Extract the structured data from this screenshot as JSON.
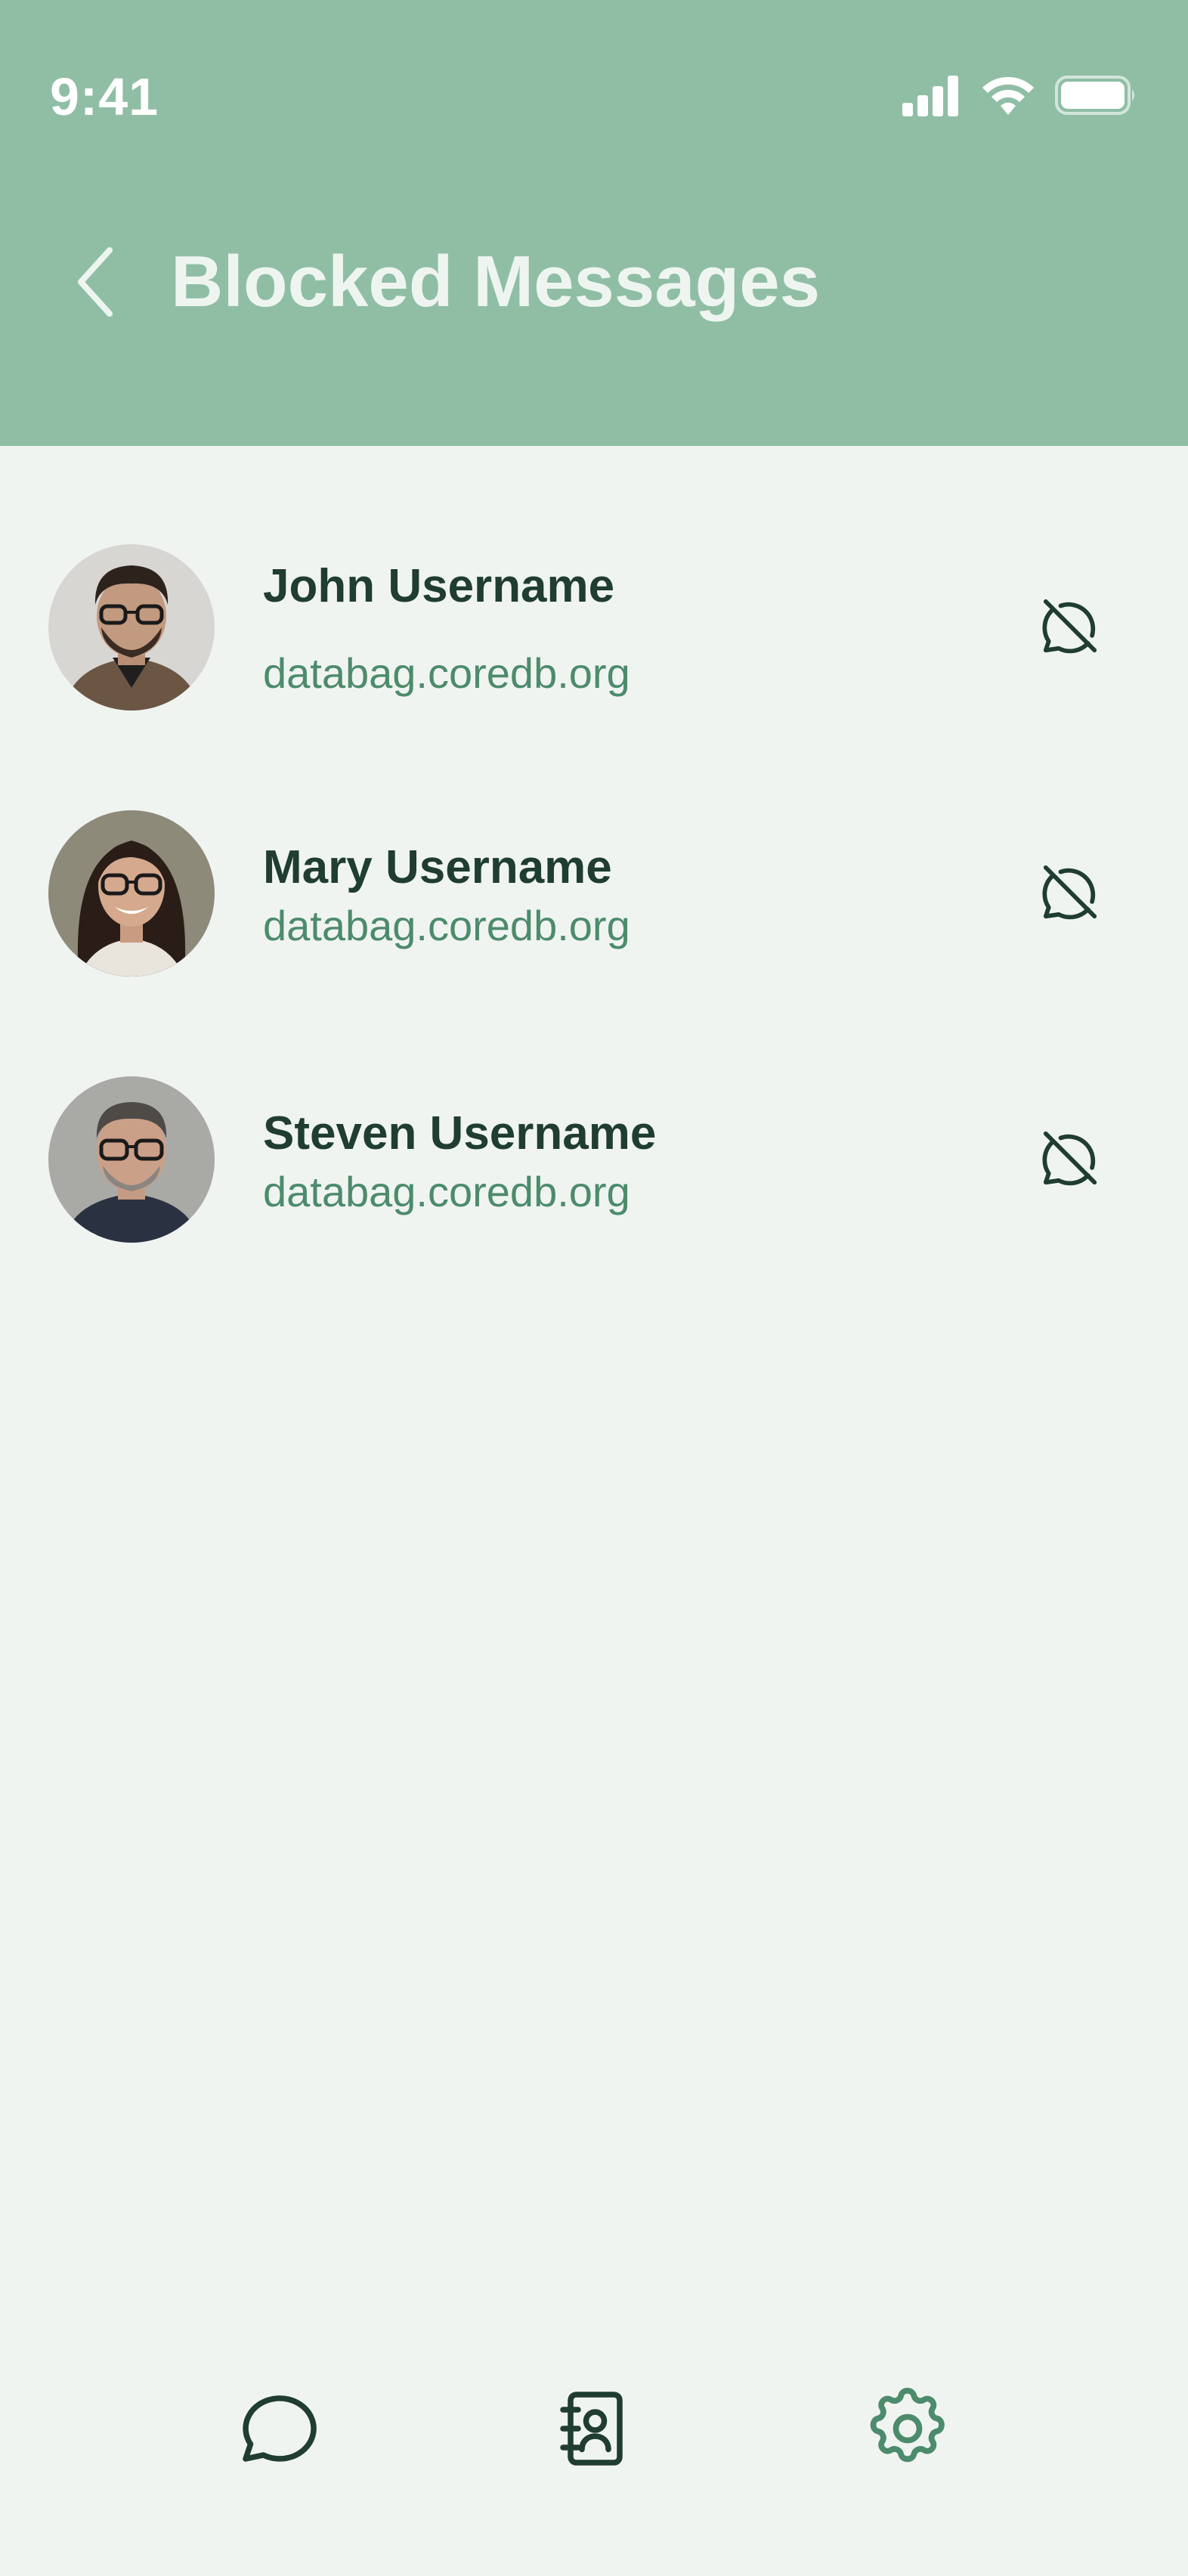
{
  "status_bar": {
    "time": "9:41",
    "icons": [
      "signal-icon",
      "wifi-icon",
      "battery-icon"
    ]
  },
  "header": {
    "title": "Blocked Messages",
    "back_icon": "chevron-left-icon"
  },
  "contacts": [
    {
      "name": "John Username",
      "domain": "databag.coredb.org",
      "action_icon": "message-off-icon"
    },
    {
      "name": "Mary Username",
      "domain": "databag.coredb.org",
      "action_icon": "message-off-icon"
    },
    {
      "name": "Steven Username",
      "domain": "databag.coredb.org",
      "action_icon": "message-off-icon"
    }
  ],
  "bottom_nav": [
    {
      "icon": "chat-bubble-icon",
      "active": false
    },
    {
      "icon": "contacts-book-icon",
      "active": false
    },
    {
      "icon": "gear-icon",
      "active": true
    }
  ],
  "colors": {
    "header_bg": "#8fbea5",
    "page_bg": "#f0f4f1",
    "title": "#eef5f0",
    "name": "#1f3d30",
    "domain": "#4c8b6b",
    "nav_active": "#4c8b6b",
    "nav_inactive": "#1f3d30"
  }
}
